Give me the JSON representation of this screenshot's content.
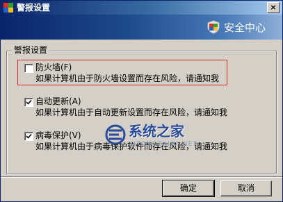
{
  "window": {
    "title": "警报设置",
    "close_label": "×"
  },
  "header": {
    "brand": "安全中心"
  },
  "group": {
    "label": "警报设置"
  },
  "items": [
    {
      "label": "防火墙(F)",
      "desc": "如果计算机由于防火墙设置而存在风险，请通知我",
      "checked": false
    },
    {
      "label": "自动更新(A)",
      "desc": "如果计算机由于自动更新设置而存在风险，请通知我",
      "checked": true
    },
    {
      "label": "病毒保护(V)",
      "desc": "如果计算机由于病毒保护软件而存在风险，请通知我",
      "checked": true
    }
  ],
  "watermark": {
    "text": "系统之家",
    "sub": "XITONGZHIJIA.NET"
  },
  "buttons": {
    "ok": "确定",
    "cancel": "取消"
  },
  "colors": {
    "title_bar": "#0a246a",
    "header_band": "#1e4a8c",
    "highlight_border": "#d62020",
    "dialog_bg": "#d4d0c8"
  },
  "icons": {
    "title": "shield-icon",
    "brand": "shield-icon",
    "watermark": "logo-icon"
  }
}
